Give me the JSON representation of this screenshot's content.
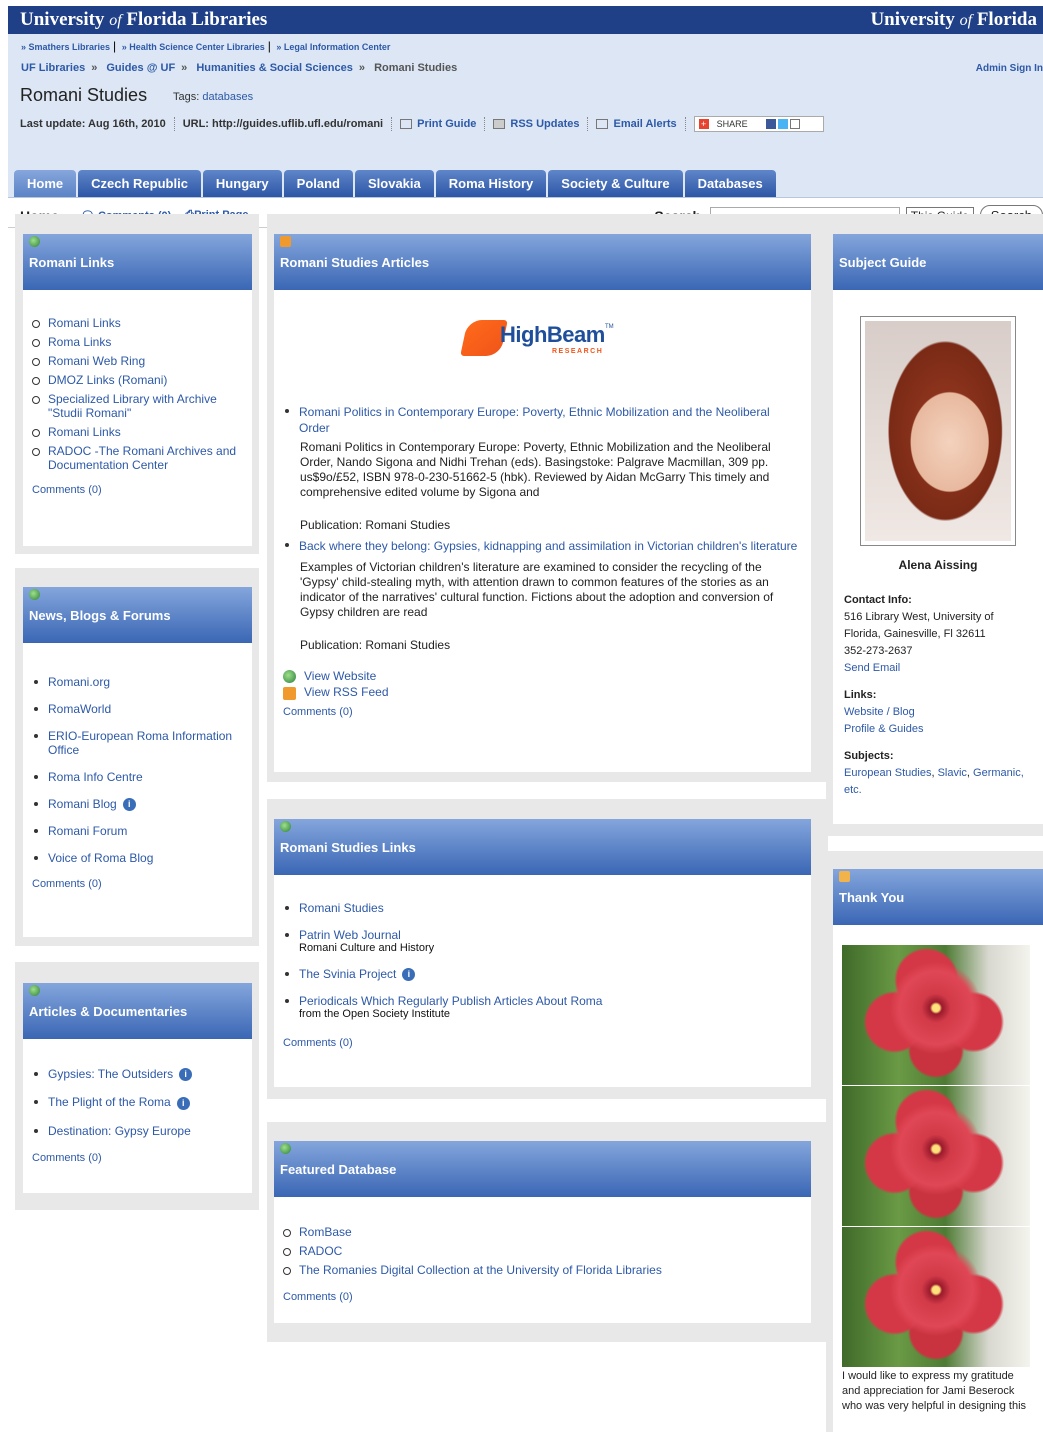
{
  "header": {
    "left": [
      "University ",
      "of",
      " Florida Libraries"
    ],
    "right": [
      "University ",
      "of",
      " Florida"
    ]
  },
  "sites": [
    "» Smathers Libraries",
    "» Health Science Center Libraries",
    "» Legal Information Center"
  ],
  "breadcrumb": [
    "UF Libraries",
    "Guides @ UF",
    "Humanities & Social Sciences",
    "Romani Studies"
  ],
  "breadcrumb_sep": "»",
  "admin": "Admin Sign In",
  "guide": {
    "title": "Romani Studies",
    "tags_label": "Tags:",
    "tags": "databases",
    "last_update": "Last update: Aug 16th, 2010",
    "url": "URL: http://guides.uflib.ufl.edu/romani",
    "print": "Print Guide",
    "rss": "RSS Updates",
    "email": "Email Alerts",
    "share": "SHARE"
  },
  "tabs": [
    "Home",
    "Czech Republic",
    "Hungary",
    "Poland",
    "Slovakia",
    "Roma History",
    "Society & Culture",
    "Databases"
  ],
  "subbar": {
    "home": "Home",
    "comments": "Comments (0)",
    "print_page": "Print Page",
    "search_label": "Search:",
    "scope": "This Guide",
    "search_btn": "Search"
  },
  "romani_links": {
    "title": "Romani Links",
    "items": [
      "Romani Links",
      "Roma Links",
      "Romani Web Ring",
      "DMOZ Links (Romani)",
      "Specialized Library with Archive \"Studii Romani\"",
      "Romani Links",
      "RADOC -The Romani Archives and Documentation Center"
    ],
    "comments": "Comments (0)"
  },
  "news": {
    "title": "News, Blogs & Forums",
    "items": [
      "Romani.org",
      "RomaWorld",
      "ERIO-European Roma Information Office",
      "Roma Info Centre",
      "Romani Blog",
      "Romani Forum",
      "Voice of Roma Blog"
    ],
    "comments": "Comments (0)"
  },
  "docs": {
    "title": "Articles & Documentaries",
    "items": [
      "Gypsies: The Outsiders",
      "The Plight of the Roma",
      "Destination: Gypsy Europe"
    ],
    "comments": "Comments (0)"
  },
  "articles": {
    "title": "Romani Studies Articles",
    "logo_main": "HighBeam",
    "logo_tm": "TM",
    "logo_sub": "RESEARCH",
    "items": [
      {
        "title": "Romani Politics in Contemporary Europe: Poverty, Ethnic Mobilization and the Neoliberal Order",
        "body": "Romani Politics in Contemporary Europe: Poverty, Ethnic Mobilization and the Neoliberal Order, Nando Sigona and Nidhi Trehan (eds). Basingstoke: Palgrave Macmillan, 309 pp. us$9o/£52, ISBN 978-0-230-51662-5 (hbk). Reviewed by Aidan McGarry This timely and comprehensive edited volume by Sigona and",
        "pub": "Publication: Romani Studies"
      },
      {
        "title": "Back where they belong: Gypsies, kidnapping and assimilation in Victorian children's literature",
        "body": "Examples of Victorian children's literature are examined to consider the recycling of the 'Gypsy' child-stealing myth, with attention drawn to common features of the stories as an indicator of the narratives' cultural function. Fictions about the adoption and conversion of Gypsy children are read",
        "pub": "Publication: Romani Studies"
      }
    ],
    "view_website": "View Website",
    "view_rss": "View RSS Feed",
    "comments": "Comments (0)"
  },
  "rs_links": {
    "title": "Romani Studies Links",
    "items": [
      {
        "label": "Romani Studies",
        "desc": ""
      },
      {
        "label": "Patrin Web Journal",
        "desc": "Romani Culture and History"
      },
      {
        "label": "The Svinia Project",
        "desc": ""
      },
      {
        "label": "Periodicals Which Regularly Publish Articles About Roma",
        "desc": "from the Open Society Institute"
      }
    ],
    "comments": "Comments (0)"
  },
  "featured": {
    "title": "Featured Database",
    "items": [
      "RomBase",
      "RADOC",
      "The Romanies Digital Collection at the University of Florida Libraries"
    ],
    "comments": "Comments (0)"
  },
  "subject_guide": {
    "title": "Subject Guide",
    "name": "Alena Aissing",
    "contact_label": "Contact Info:",
    "contact": "516 Library West, University of Florida, Gainesville, Fl 32611",
    "phone": "352-273-2637",
    "email": "Send Email",
    "links_label": "Links:",
    "links": [
      "Website / Blog",
      "Profile & Guides"
    ],
    "subjects_label": "Subjects:",
    "subjects": [
      "European Studies",
      "Slavic",
      "Germanic, etc."
    ],
    "subjects_sep": ", "
  },
  "thanks": {
    "title": "Thank You",
    "text": "I would like to express my gratitude and appreciation for Jami Beserock who was very helpful in designing this"
  }
}
